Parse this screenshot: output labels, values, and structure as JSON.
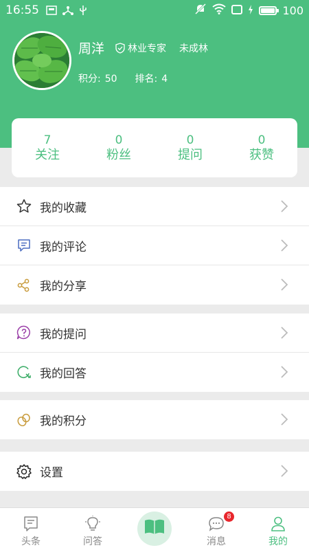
{
  "status_bar": {
    "time": "16:55",
    "battery": "100",
    "battery_level": 1.0
  },
  "profile": {
    "name": "周洋",
    "title": "林业专家",
    "age_group": "未成林",
    "points_label": "积分:",
    "points_value": "50",
    "rank_label": "排名:",
    "rank_value": "4"
  },
  "stats": [
    {
      "value": "7",
      "label": "关注"
    },
    {
      "value": "0",
      "label": "粉丝"
    },
    {
      "value": "0",
      "label": "提问"
    },
    {
      "value": "0",
      "label": "获赞"
    }
  ],
  "menu": {
    "favorites": "我的收藏",
    "comments": "我的评论",
    "shares": "我的分享",
    "questions": "我的提问",
    "answers": "我的回答",
    "points": "我的积分",
    "settings": "设置"
  },
  "tabs": {
    "headlines": "头条",
    "qa": "问答",
    "messages": "消息",
    "mine": "我的",
    "message_badge": "8"
  },
  "colors": {
    "brand": "#4cbf80",
    "badge": "#e8262c"
  }
}
